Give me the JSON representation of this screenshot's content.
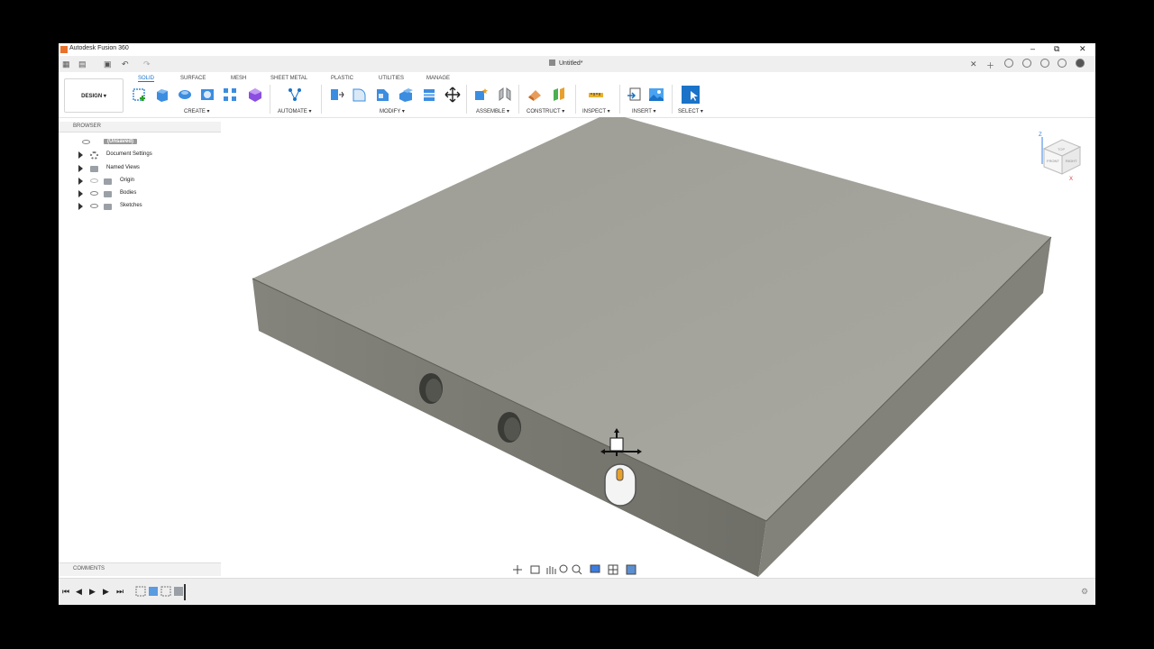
{
  "app": {
    "title": "Autodesk Fusion 360",
    "doc_tab": "Untitled*"
  },
  "window_controls": {
    "minimize": "–",
    "maximize": "⧉",
    "close": "✕"
  },
  "ribbon": {
    "workspace_label": "DESIGN ▾",
    "tabs": [
      {
        "label": "SOLID",
        "active": true
      },
      {
        "label": "SURFACE"
      },
      {
        "label": "MESH"
      },
      {
        "label": "SHEET METAL"
      },
      {
        "label": "PLASTIC"
      },
      {
        "label": "UTILITIES"
      },
      {
        "label": "MANAGE"
      }
    ],
    "groups": [
      "CREATE ▾",
      "AUTOMATE ▾",
      "MODIFY ▾",
      "ASSEMBLE ▾",
      "CONSTRUCT ▾",
      "INSPECT ▾",
      "INSERT ▾",
      "SELECT ▾"
    ]
  },
  "browser": {
    "header": "BROWSER",
    "root": "(Unsaved)",
    "items": [
      "Document Settings",
      "Named Views",
      "Origin",
      "Bodies",
      "Sketches"
    ]
  },
  "comments": {
    "header": "COMMENTS"
  },
  "viewcube": {
    "top": "TOP",
    "front": "FRONT",
    "right": "RIGHT",
    "axis_z": "Z",
    "axis_x": "X"
  },
  "colors": {
    "accent": "#1a73c8",
    "body_top": "#a6a69e",
    "body_side": "#787870"
  }
}
